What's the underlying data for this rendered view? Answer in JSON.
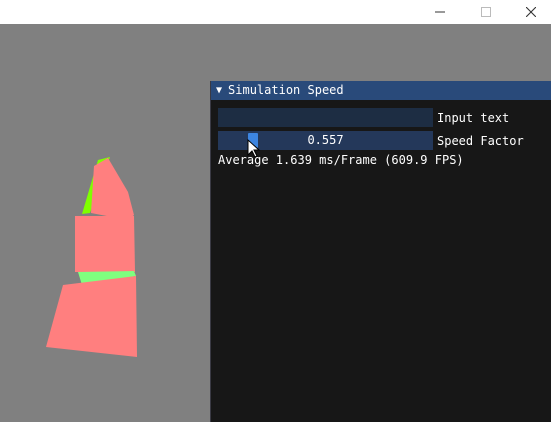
{
  "window": {
    "minimize_glyph": "—",
    "maximize_glyph": "□",
    "close_glyph": "✕"
  },
  "panel": {
    "title": "Simulation Speed",
    "collapse_icon": "triangle-down-icon",
    "input": {
      "label": "Input text",
      "value": ""
    },
    "slider": {
      "label": "Speed Factor",
      "value_text": "0.557"
    },
    "stats": "Average 1.639 ms/Frame (609.9 FPS)"
  },
  "colors": {
    "background": "#808080",
    "panel_bg": "#171717",
    "header_bg": "#294a7a",
    "frame_bg": "#1d2d43",
    "grab": "#3d85e0",
    "shape_red": "#ff7f7f",
    "shape_green": "#7fff7f",
    "shape_lime": "#7fff00"
  }
}
